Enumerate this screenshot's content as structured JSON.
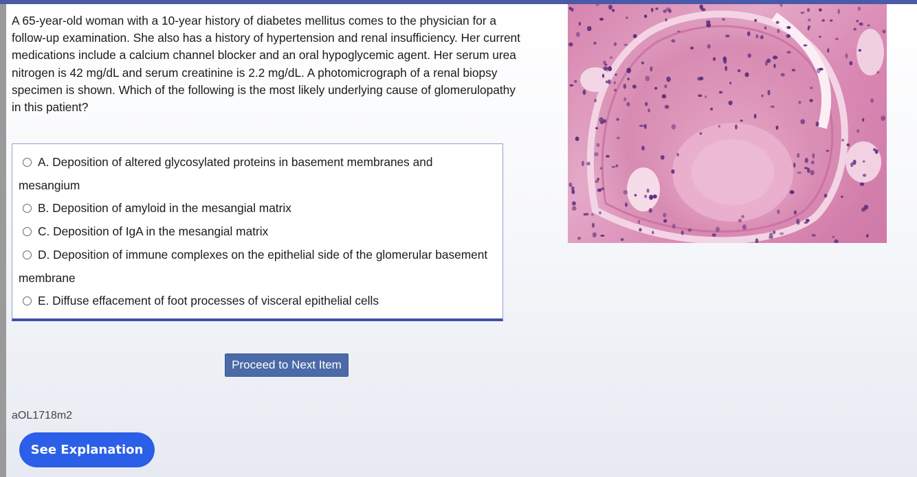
{
  "question": {
    "stem": "A 65-year-old woman with a 10-year history of diabetes mellitus comes to the physician for a follow-up examination. She also has a history of hypertension and renal insufficiency. Her current medications include a calcium channel blocker and an oral hypoglycemic agent. Her serum urea nitrogen is 42 mg/dL and serum creatinine is 2.2 mg/dL. A photomicrograph of a renal biopsy specimen is shown. Which of the following is the most likely underlying cause of glomerulopathy in this patient?",
    "options": [
      {
        "label": "A. Deposition of altered glycosylated proteins in basement membranes and mesangium"
      },
      {
        "label": "B. Deposition of amyloid in the mesangial matrix"
      },
      {
        "label": "C. Deposition of IgA in the mesangial matrix"
      },
      {
        "label": "D. Deposition of immune complexes on the epithelial side of the glomerular basement membrane"
      },
      {
        "label": "E. Diffuse effacement of foot processes of visceral epithelial cells"
      }
    ]
  },
  "image": {
    "alt": "Photomicrograph of renal biopsy specimen"
  },
  "buttons": {
    "proceed_label": "Proceed to Next Item",
    "explanation_label": "See Explanation"
  },
  "item_id": "aOL1718m2",
  "colors": {
    "top_bar": "#4a5aa8",
    "proceed_button": "#4b6aa7",
    "explanation_button": "#2b5fe8",
    "answer_border": "#3e52a3"
  }
}
